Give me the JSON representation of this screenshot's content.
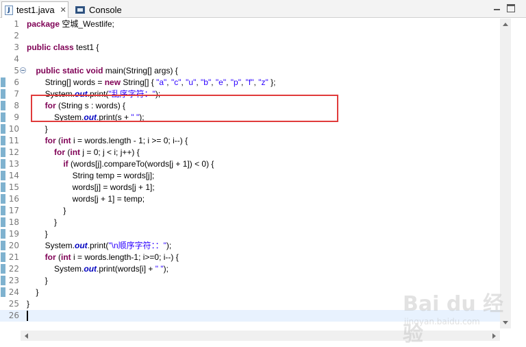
{
  "tabs": {
    "java_tab_label": "test1.java",
    "java_tab_close": "✕",
    "console_tab_label": "Console"
  },
  "editor": {
    "lines": [
      {
        "n": "1",
        "parts": [
          [
            "kw",
            "package"
          ],
          [
            "t",
            " 空城_Westlife;"
          ]
        ]
      },
      {
        "n": "2",
        "parts": []
      },
      {
        "n": "3",
        "parts": [
          [
            "kw",
            "public"
          ],
          [
            "t",
            " "
          ],
          [
            "kw",
            "class"
          ],
          [
            "t",
            " test1 {"
          ]
        ]
      },
      {
        "n": "4",
        "parts": []
      },
      {
        "n": "5",
        "parts": [
          [
            "t",
            "    "
          ],
          [
            "kw",
            "public"
          ],
          [
            "t",
            " "
          ],
          [
            "kw",
            "static"
          ],
          [
            "t",
            " "
          ],
          [
            "kw",
            "void"
          ],
          [
            "t",
            " main(String[] args) {"
          ]
        ]
      },
      {
        "n": "6",
        "parts": [
          [
            "t",
            "        String[] words = "
          ],
          [
            "kw",
            "new"
          ],
          [
            "t",
            " String[] { "
          ],
          [
            "str",
            "\"a\""
          ],
          [
            "t",
            ", "
          ],
          [
            "str",
            "\"c\""
          ],
          [
            "t",
            ", "
          ],
          [
            "str",
            "\"u\""
          ],
          [
            "t",
            ", "
          ],
          [
            "str",
            "\"b\""
          ],
          [
            "t",
            ", "
          ],
          [
            "str",
            "\"e\""
          ],
          [
            "t",
            ", "
          ],
          [
            "str",
            "\"p\""
          ],
          [
            "t",
            ", "
          ],
          [
            "str",
            "\"f\""
          ],
          [
            "t",
            ", "
          ],
          [
            "str",
            "\"z\""
          ],
          [
            "t",
            " };"
          ]
        ]
      },
      {
        "n": "7",
        "parts": [
          [
            "t",
            "        System."
          ],
          [
            "fld",
            "out"
          ],
          [
            "t",
            ".print("
          ],
          [
            "str",
            "\"乱序字符：\""
          ],
          [
            "t",
            ");"
          ]
        ]
      },
      {
        "n": "8",
        "parts": [
          [
            "t",
            "        "
          ],
          [
            "kw",
            "for"
          ],
          [
            "t",
            " (String s : words) {"
          ]
        ]
      },
      {
        "n": "9",
        "parts": [
          [
            "t",
            "            System."
          ],
          [
            "fld",
            "out"
          ],
          [
            "t",
            ".print(s + "
          ],
          [
            "str",
            "\" \""
          ],
          [
            "t",
            ");"
          ]
        ]
      },
      {
        "n": "10",
        "parts": [
          [
            "t",
            "        }"
          ]
        ]
      },
      {
        "n": "11",
        "parts": [
          [
            "t",
            "        "
          ],
          [
            "kw",
            "for"
          ],
          [
            "t",
            " ("
          ],
          [
            "kw",
            "int"
          ],
          [
            "t",
            " i = words.length - 1; i >= 0; i--) {"
          ]
        ]
      },
      {
        "n": "12",
        "parts": [
          [
            "t",
            "            "
          ],
          [
            "kw",
            "for"
          ],
          [
            "t",
            " ("
          ],
          [
            "kw",
            "int"
          ],
          [
            "t",
            " j = 0; j < i; j++) {"
          ]
        ]
      },
      {
        "n": "13",
        "parts": [
          [
            "t",
            "                "
          ],
          [
            "kw",
            "if"
          ],
          [
            "t",
            " (words[j].compareTo(words[j + 1]) < 0) {"
          ]
        ]
      },
      {
        "n": "14",
        "parts": [
          [
            "t",
            "                    String temp = words[j];"
          ]
        ]
      },
      {
        "n": "15",
        "parts": [
          [
            "t",
            "                    words[j] = words[j + 1];"
          ]
        ]
      },
      {
        "n": "16",
        "parts": [
          [
            "t",
            "                    words[j + 1] = temp;"
          ]
        ]
      },
      {
        "n": "17",
        "parts": [
          [
            "t",
            "                }"
          ]
        ]
      },
      {
        "n": "18",
        "parts": [
          [
            "t",
            "            }"
          ]
        ]
      },
      {
        "n": "19",
        "parts": [
          [
            "t",
            "        }"
          ]
        ]
      },
      {
        "n": "20",
        "parts": [
          [
            "t",
            "        System."
          ],
          [
            "fld",
            "out"
          ],
          [
            "t",
            ".print("
          ],
          [
            "str",
            "\"\\n顺序字符：：\""
          ],
          [
            "t",
            ");"
          ]
        ]
      },
      {
        "n": "21",
        "parts": [
          [
            "t",
            "        "
          ],
          [
            "kw",
            "for"
          ],
          [
            "t",
            " ("
          ],
          [
            "kw",
            "int"
          ],
          [
            "t",
            " i = words.length-1; i>=0; i--) {"
          ]
        ]
      },
      {
        "n": "22",
        "parts": [
          [
            "t",
            "            System."
          ],
          [
            "fld",
            "out"
          ],
          [
            "t",
            ".print(words[i] + "
          ],
          [
            "str",
            "\" \""
          ],
          [
            "t",
            ");"
          ]
        ]
      },
      {
        "n": "23",
        "parts": [
          [
            "t",
            "        }"
          ]
        ]
      },
      {
        "n": "24",
        "parts": [
          [
            "t",
            "    }"
          ]
        ]
      },
      {
        "n": "25",
        "parts": [
          [
            "t",
            "}"
          ]
        ]
      },
      {
        "n": "26",
        "parts": []
      }
    ],
    "current_line": "26",
    "folded_line": "5"
  },
  "watermark": {
    "logo": "Bai du 经验",
    "url": "jingyan.baidu.com"
  },
  "colors": {
    "keyword": "#7f0055",
    "string": "#2a00ff",
    "static_field": "#0000c0",
    "highlight_box": "#e03a3a",
    "current_line_bg": "#e8f2fe"
  }
}
